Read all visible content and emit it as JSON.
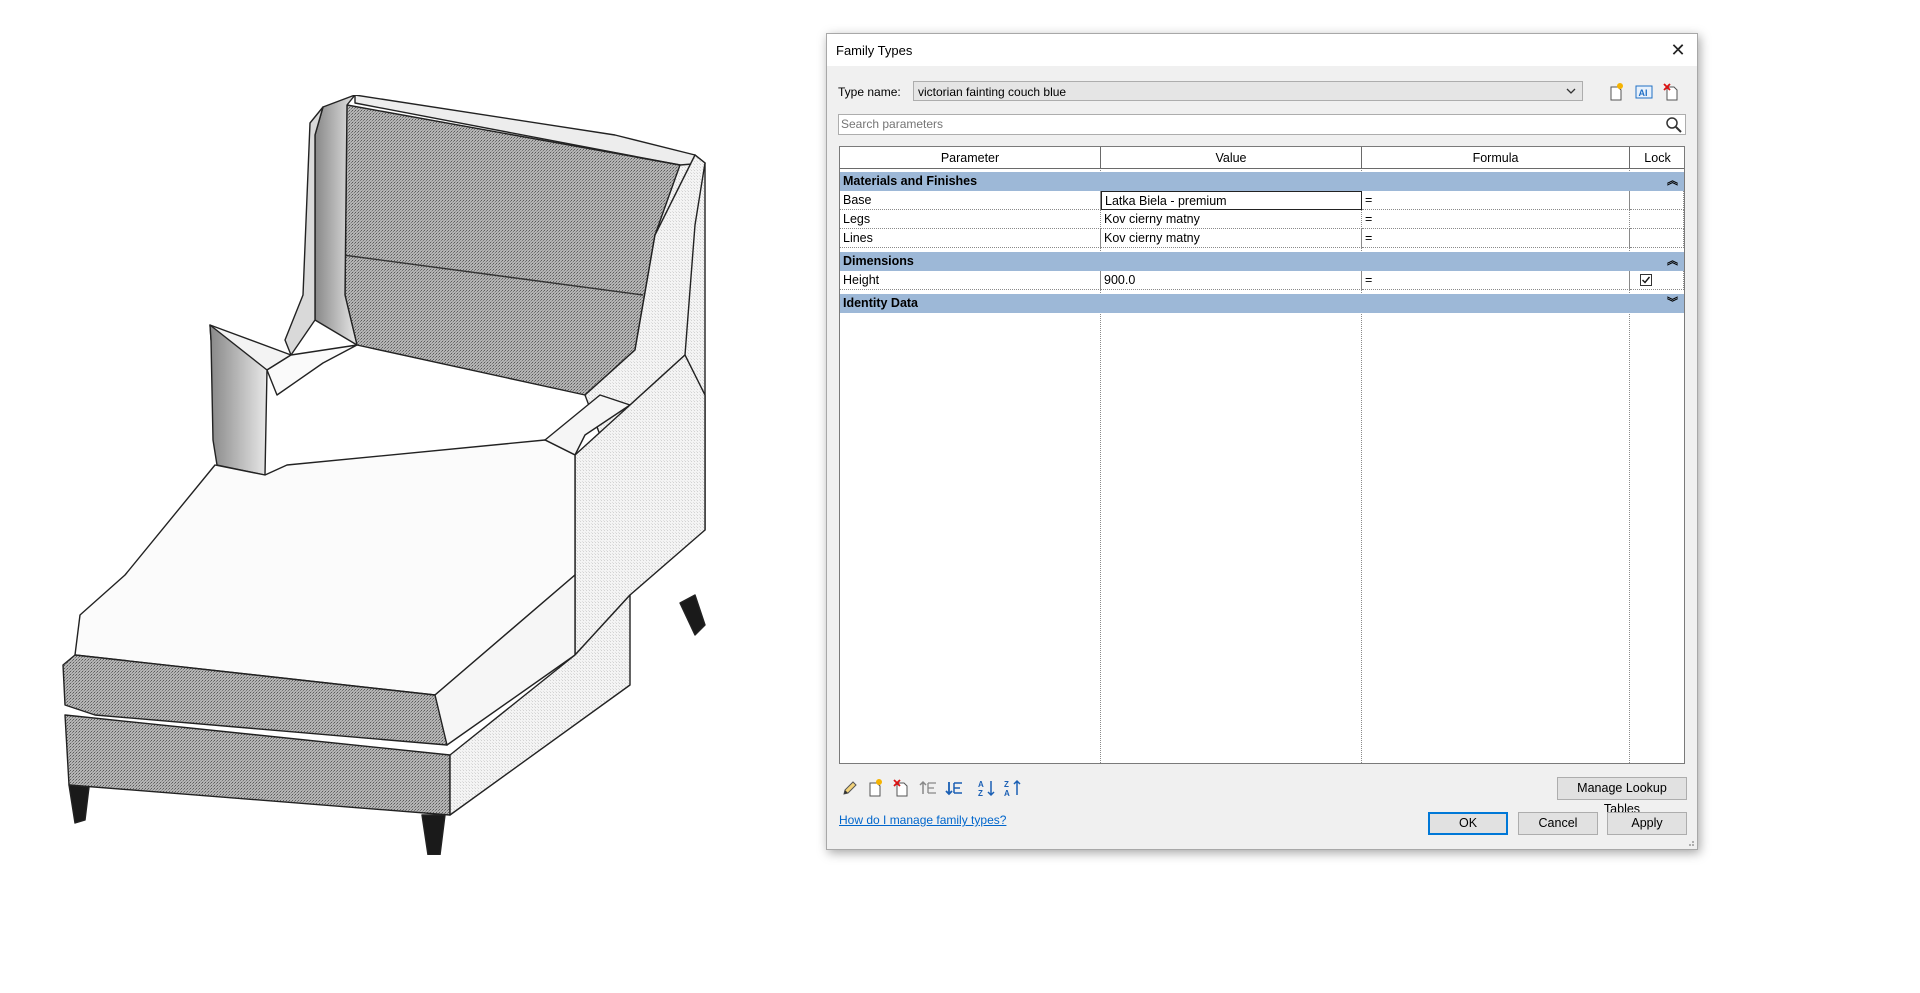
{
  "dialog": {
    "title": "Family Types",
    "close_icon": "close-icon",
    "type_name_label": "Type name:",
    "type_name_value": "victorian fainting couch blue",
    "toolbar_icons": [
      "new-type-icon",
      "rename-type-icon",
      "delete-type-icon"
    ],
    "search_placeholder": "Search parameters",
    "columns": [
      "Parameter",
      "Value",
      "Formula",
      "Lock"
    ],
    "groups": [
      {
        "name": "Materials and Finishes",
        "expanded": true,
        "rows": [
          {
            "parameter": "Base",
            "value": "Latka Biela - premium",
            "formula": "=",
            "lock": null
          },
          {
            "parameter": "Legs",
            "value": "Kov cierny matny",
            "formula": "=",
            "lock": null
          },
          {
            "parameter": "Lines",
            "value": "Kov cierny matny",
            "formula": "=",
            "lock": null
          }
        ]
      },
      {
        "name": "Dimensions",
        "expanded": true,
        "rows": [
          {
            "parameter": "Height",
            "value": "900.0",
            "formula": "=",
            "lock": true
          }
        ]
      },
      {
        "name": "Identity Data",
        "expanded": false,
        "rows": []
      }
    ],
    "bottom_toolbar_icons": [
      "edit-parameter-icon",
      "new-parameter-icon",
      "delete-parameter-icon",
      "move-up-icon",
      "move-down-icon",
      "sort-ascending-icon",
      "sort-descending-icon"
    ],
    "manage_lookup_label": "Manage Lookup Tables",
    "help_link": "How do I manage family types?",
    "ok_label": "OK",
    "cancel_label": "Cancel",
    "apply_label": "Apply",
    "group_header_color": "#9db8d7",
    "selection_border_color": "#0078d7"
  }
}
